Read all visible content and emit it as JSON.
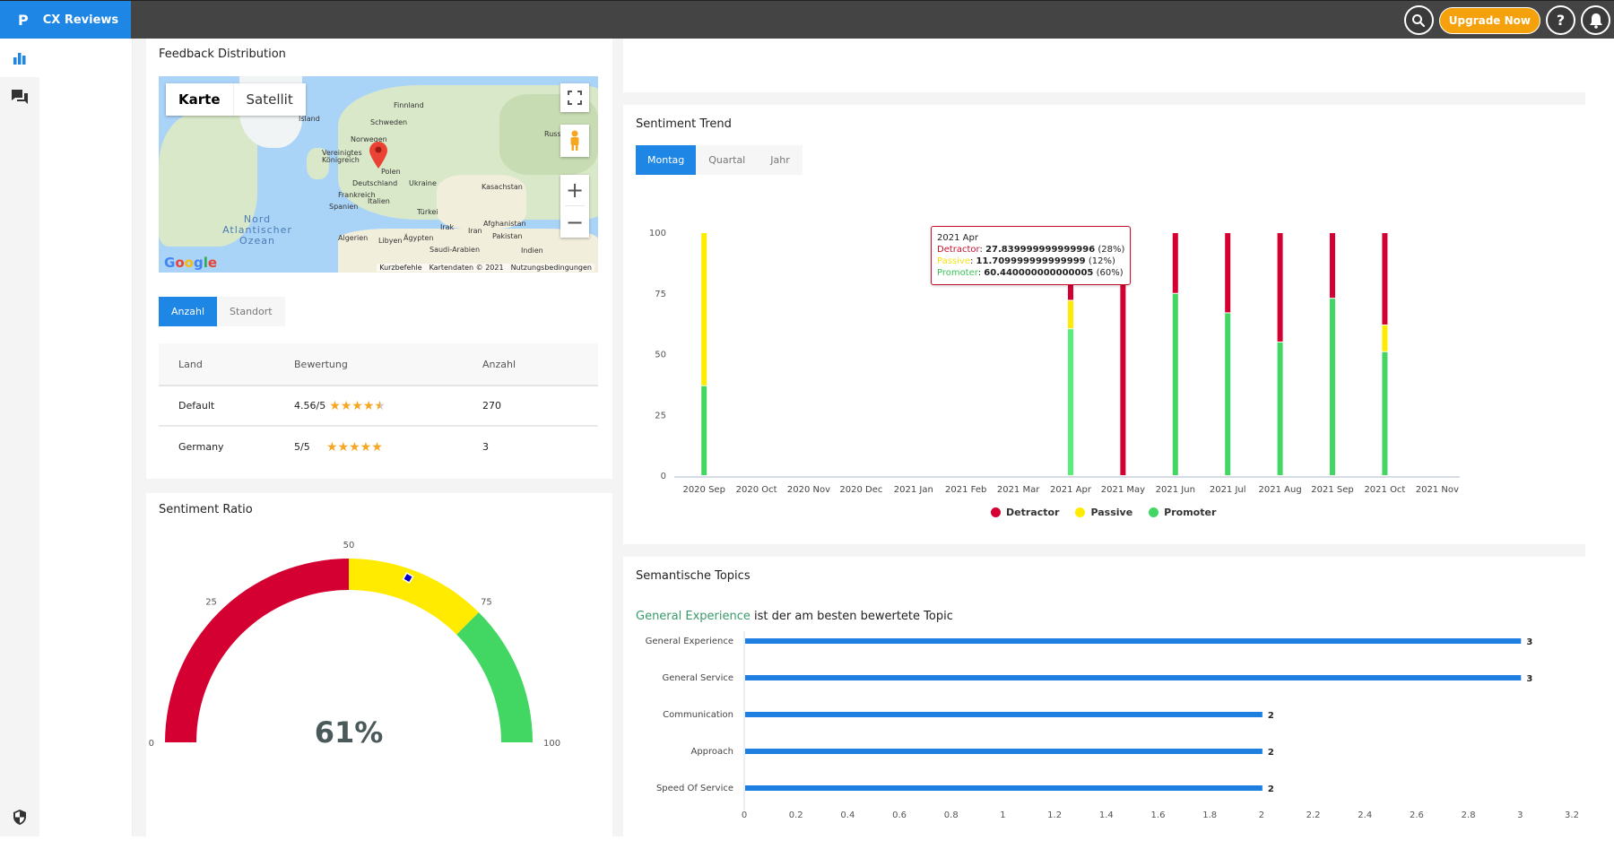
{
  "app": {
    "brand_logo": "P",
    "brand_name": "CX Reviews",
    "upgrade_label": "Upgrade Now",
    "search_icon": "search-icon",
    "help_icon": "help-icon",
    "bell_icon": "bell-icon",
    "help_glyph": "?"
  },
  "sidebar": {
    "items": [
      {
        "icon": "bar-chart-icon",
        "active": true
      },
      {
        "icon": "chat-bubbles-icon",
        "active": false
      }
    ],
    "bottom_icon": "shield-icon"
  },
  "feedback_distribution": {
    "title": "Feedback Distribution",
    "map": {
      "type_options": [
        "Karte",
        "Satellit"
      ],
      "selected_type": "Karte",
      "labels": [
        "Finnland",
        "Island",
        "Schweden",
        "Norwegen",
        "Russland",
        "Vereinigtes Königreich",
        "Polen",
        "Deutschland",
        "Ukraine",
        "Kasachstan",
        "Frankreich",
        "Spanien",
        "Italien",
        "Türkei",
        "Afghanistan",
        "Irak",
        "Iran",
        "Pakistan",
        "Algerien",
        "Libyen",
        "Ägypten",
        "Saudi-Arabien",
        "Indien"
      ],
      "ocean_label": "Nord Atlantischer Ozean",
      "footer": [
        "Kurzbefehle",
        "Kartendaten © 2021",
        "Nutzungsbedingungen"
      ],
      "logo": "Google",
      "marker_location": "Deutschland"
    },
    "tabs": [
      "Anzahl",
      "Standort"
    ],
    "active_tab": "Anzahl",
    "table": {
      "headers": [
        "Land",
        "Bewertung",
        "Anzahl"
      ],
      "rows": [
        {
          "land": "Default",
          "rating_text": "4.56/5",
          "rating": 4.56,
          "count": "270"
        },
        {
          "land": "Germany",
          "rating_text": "5/5",
          "rating": 5,
          "count": "3"
        }
      ]
    }
  },
  "sentiment_ratio": {
    "title": "Sentiment Ratio",
    "value_text": "61%",
    "value": 61,
    "ticks": [
      "0",
      "25",
      "50",
      "75",
      "100"
    ],
    "bands": [
      {
        "from": 0,
        "to": 50,
        "color": "#d50032"
      },
      {
        "from": 50,
        "to": 75,
        "color": "#ffeb00"
      },
      {
        "from": 75,
        "to": 100,
        "color": "#42d762"
      }
    ]
  },
  "sentiment_trend": {
    "title": "Sentiment Trend",
    "tabs": [
      "Montag",
      "Quartal",
      "Jahr"
    ],
    "active_tab": "Montag",
    "tooltip": {
      "title": "2021 Apr",
      "lines": [
        {
          "label": "Detractor",
          "value": "27.839999999999996",
          "pct": "(28%)",
          "color": "#c8102e"
        },
        {
          "label": "Passive",
          "value": "11.709999999999999",
          "pct": "(12%)",
          "color": "#f2e21a"
        },
        {
          "label": "Promoter",
          "value": "60.440000000000005",
          "pct": "(60%)",
          "color": "#3cc35a"
        }
      ]
    }
  },
  "semantic_topics": {
    "title": "Semantische Topics",
    "highlight_topic": "General Experience",
    "highlight_suffix": " ist der am besten bewertete Topic",
    "menu_icon": "chart-menu-icon"
  },
  "chart_data": [
    {
      "type": "bar",
      "stacked": true,
      "title": "Sentiment Trend",
      "categories": [
        "2020 Sep",
        "2020 Oct",
        "2020 Nov",
        "2020 Dec",
        "2021 Jan",
        "2021 Feb",
        "2021 Mar",
        "2021 Apr",
        "2021 May",
        "2021 Jun",
        "2021 Jul",
        "2021 Aug",
        "2021 Sep",
        "2021 Oct",
        "2021 Nov"
      ],
      "series": [
        {
          "name": "Promoter",
          "color": "#42d762",
          "values": [
            37,
            0,
            0,
            0,
            0,
            0,
            0,
            60.44,
            0,
            75,
            67,
            55,
            73,
            51,
            0
          ]
        },
        {
          "name": "Passive",
          "color": "#ffeb00",
          "values": [
            63,
            0,
            0,
            0,
            0,
            0,
            0,
            11.71,
            0,
            0,
            0,
            0,
            0,
            11,
            0
          ]
        },
        {
          "name": "Detractor",
          "color": "#d50032",
          "values": [
            0,
            0,
            0,
            0,
            0,
            0,
            0,
            27.84,
            100,
            25,
            33,
            45,
            27,
            38,
            0
          ]
        }
      ],
      "yticks": [
        "0",
        "25",
        "50",
        "75",
        "100"
      ],
      "ylim": [
        0,
        100
      ],
      "legend": "bottom",
      "grid": false
    },
    {
      "type": "bar",
      "orientation": "horizontal",
      "title": "Semantische Topics",
      "categories": [
        "General Experience",
        "General Service",
        "Communication",
        "Approach",
        "Speed Of Service"
      ],
      "values": [
        3,
        3,
        2,
        2,
        2
      ],
      "data_labels": [
        "3",
        "3",
        "2",
        "2",
        "2"
      ],
      "color": "#1e7fe0",
      "xticks": [
        "0",
        "0.2",
        "0.4",
        "0.6",
        "0.8",
        "1",
        "1.2",
        "1.4",
        "1.6",
        "1.8",
        "2",
        "2.2",
        "2.4",
        "2.6",
        "2.8",
        "3",
        "3.2"
      ],
      "xlim": [
        0,
        3.2
      ],
      "grid": false
    }
  ]
}
